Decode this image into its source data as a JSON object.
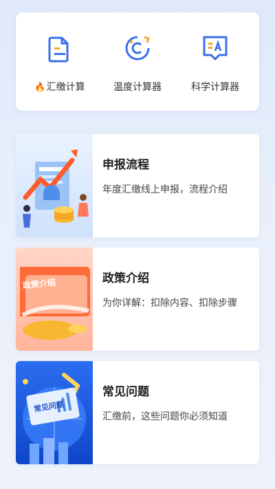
{
  "tools": [
    {
      "icon": "document-calc-icon",
      "prefix": "🔥",
      "label": "汇缴计算"
    },
    {
      "icon": "temperature-c-icon",
      "prefix": "",
      "label": "温度计算器"
    },
    {
      "icon": "scientific-calc-icon",
      "prefix": "",
      "label": "科学计算器"
    }
  ],
  "cards": [
    {
      "title": "申报流程",
      "desc": "年度汇缴线上申报，流程介绍",
      "image_icon": "report-growth-illustration"
    },
    {
      "title": "政策介绍",
      "desc": "为你详解：扣除内容、扣除步骤",
      "image_icon": "policy-ticket-illustration",
      "image_text": "政策介绍"
    },
    {
      "title": "常见问题",
      "desc": "汇缴前，这些问题你必须知道",
      "image_icon": "faq-globe-illustration",
      "image_text": "常见问题"
    }
  ]
}
